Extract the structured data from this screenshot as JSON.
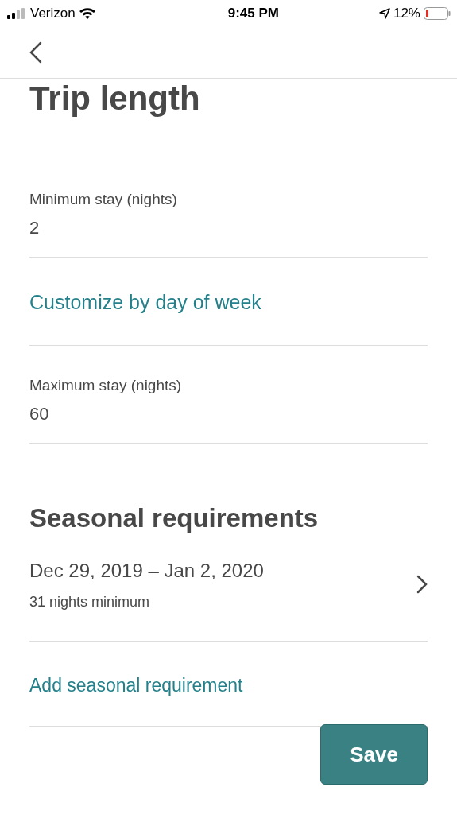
{
  "status_bar": {
    "carrier": "Verizon",
    "time": "9:45 PM",
    "battery": "12%"
  },
  "title": "Trip length",
  "fields": [
    {
      "label": "Minimum stay (nights)",
      "value": "2"
    }
  ],
  "customize_link": "Customize by day of week",
  "max_field": {
    "label": "Maximum stay (nights)",
    "value": "60"
  },
  "seasonal": {
    "heading": "Seasonal requirements",
    "items": [
      {
        "dates": "Dec 29, 2019 – Jan 2, 2020",
        "detail": "31 nights minimum"
      }
    ],
    "add_link": "Add seasonal requirement"
  },
  "save_button": "Save"
}
